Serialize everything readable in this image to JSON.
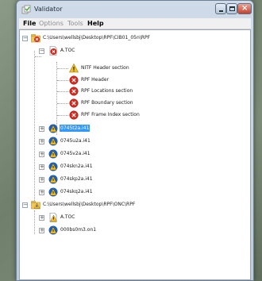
{
  "window": {
    "title": "Validator"
  },
  "menu": {
    "items": [
      {
        "label": "File",
        "enabled": true
      },
      {
        "label": "Options",
        "enabled": false
      },
      {
        "label": "Tools",
        "enabled": false
      },
      {
        "label": "Help",
        "enabled": true
      }
    ]
  },
  "tree": {
    "root1": {
      "label": "C:\\Users\\wellsbj\\Desktop\\RPF\\CIB01_05n\\RPF",
      "toc": {
        "label": "A.TOC",
        "children": [
          {
            "label": "NITF Header section",
            "status": "warning"
          },
          {
            "label": "RPF Header",
            "status": "error"
          },
          {
            "label": "RPF Locations section",
            "status": "error"
          },
          {
            "label": "RPF Boundary section",
            "status": "error"
          },
          {
            "label": "RPF Frame Index section",
            "status": "error"
          }
        ]
      },
      "files": [
        {
          "label": "0745t2a.i41",
          "selected": true
        },
        {
          "label": "0745u2a.i41"
        },
        {
          "label": "0745v2a.i41"
        },
        {
          "label": "074skn2a.i41"
        },
        {
          "label": "074skp2a.i41"
        },
        {
          "label": "074skq2a.i41"
        }
      ]
    },
    "root2": {
      "label": "C:\\Users\\wellsbj\\Desktop\\RPF\\ONC\\RPF",
      "children": [
        {
          "label": "A.TOC",
          "status": "toc-warning"
        },
        {
          "label": "000bs0m3.on1",
          "status": "warning"
        }
      ]
    }
  },
  "colors": {
    "selection": "#3399ff",
    "error": "#d42a1e",
    "warning": "#f3c222",
    "file_blue": "#1f5fb8"
  }
}
